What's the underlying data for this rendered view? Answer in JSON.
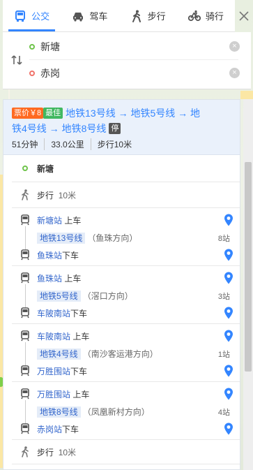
{
  "tabs": [
    {
      "label": "公交",
      "icon": "bus-icon",
      "active": true
    },
    {
      "label": "驾车",
      "icon": "car-icon",
      "active": false
    },
    {
      "label": "步行",
      "icon": "walk-icon",
      "active": false
    },
    {
      "label": "骑行",
      "icon": "bike-icon",
      "active": false
    }
  ],
  "route": {
    "from": "新塘",
    "to": "赤岗"
  },
  "summary": {
    "price_tag": "票价￥8",
    "best_tag": "最佳",
    "line_text_1": "地铁13号线 → 地铁5号线 → 地",
    "line_text_2": "铁4号线 → 地铁8号线",
    "stop_tag": "停",
    "duration": "51分钟",
    "distance": "33.0公里",
    "walk": "步行10米"
  },
  "steps": {
    "start": "新塘",
    "walk1": "步行",
    "walk1_dist": "10米",
    "seg1_board_station": "新塘站",
    "seg1_board_action": "上车",
    "seg1_line": "地铁13号线",
    "seg1_dir": "（鱼珠方向）",
    "seg1_count": "8站",
    "seg1_alight_station": "鱼珠站",
    "seg1_alight_action": "下车",
    "seg2_board_station": "鱼珠站",
    "seg2_board_action": "上车",
    "seg2_line": "地铁5号线",
    "seg2_dir": "（滘口方向）",
    "seg2_count": "3站",
    "seg2_alight_station": "车陂南站",
    "seg2_alight_action": "下车",
    "seg3_board_station": "车陂南站",
    "seg3_board_action": "上车",
    "seg3_line": "地铁4号线",
    "seg3_dir": "（南沙客运港方向）",
    "seg3_count": "1站",
    "seg3_alight_station": "万胜围站",
    "seg3_alight_action": "下车",
    "seg4_board_station": "万胜围站",
    "seg4_board_action": "上车",
    "seg4_line": "地铁8号线",
    "seg4_dir": "（凤凰新村方向）",
    "seg4_count": "4站",
    "seg4_alight_station": "赤岗站",
    "seg4_alight_action": "下车",
    "walk2": "步行",
    "walk2_dist": "10米",
    "end": "赤岗"
  },
  "colors": {
    "accent": "#3385ff",
    "start_dot": "#6fc44b",
    "end_dot": "#f0736a",
    "price_tag": "#ff6a21",
    "best_tag": "#41b861"
  }
}
